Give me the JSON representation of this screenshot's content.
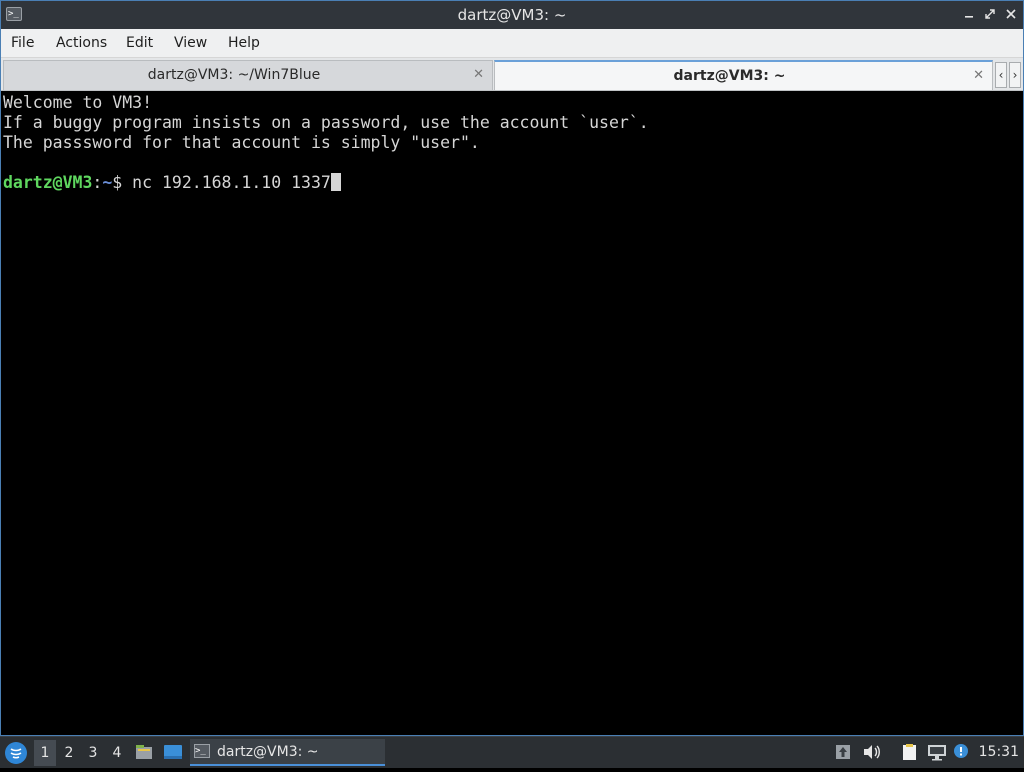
{
  "window": {
    "title": "dartz@VM3: ~",
    "app_icon": ">_",
    "minimize_glyph": "▬",
    "maximize_glyph": "⤡",
    "close_glyph": "✕"
  },
  "menu": [
    "File",
    "Actions",
    "Edit",
    "View",
    "Help"
  ],
  "tabs": [
    {
      "label": "dartz@VM3: ~/Win7Blue",
      "active": false,
      "close": "✕"
    },
    {
      "label": "dartz@VM3: ~",
      "active": true,
      "close": "✕"
    }
  ],
  "tab_scroll": {
    "left": "‹",
    "right": "›"
  },
  "terminal": {
    "lines": [
      "Welcome to VM3!",
      "If a buggy program insists on a password, use the account `user`.",
      "The passsword for that account is simply \"user\"."
    ],
    "prompt_user": "dartz@VM3",
    "prompt_sep": ":",
    "prompt_path": "~",
    "prompt_symbol": "$ ",
    "command": "nc 192.168.1.10 1337"
  },
  "taskbar": {
    "start_icon": "start-menu-icon",
    "workspaces": [
      "1",
      "2",
      "3",
      "4"
    ],
    "current_workspace": "1",
    "task_label": "dartz@VM3: ~",
    "task_icon": ">_",
    "clock": "15:31",
    "colors": {
      "accent": "#4a90d9",
      "prompt_user": "#5fd75f",
      "prompt_path": "#6b8fd8"
    }
  }
}
